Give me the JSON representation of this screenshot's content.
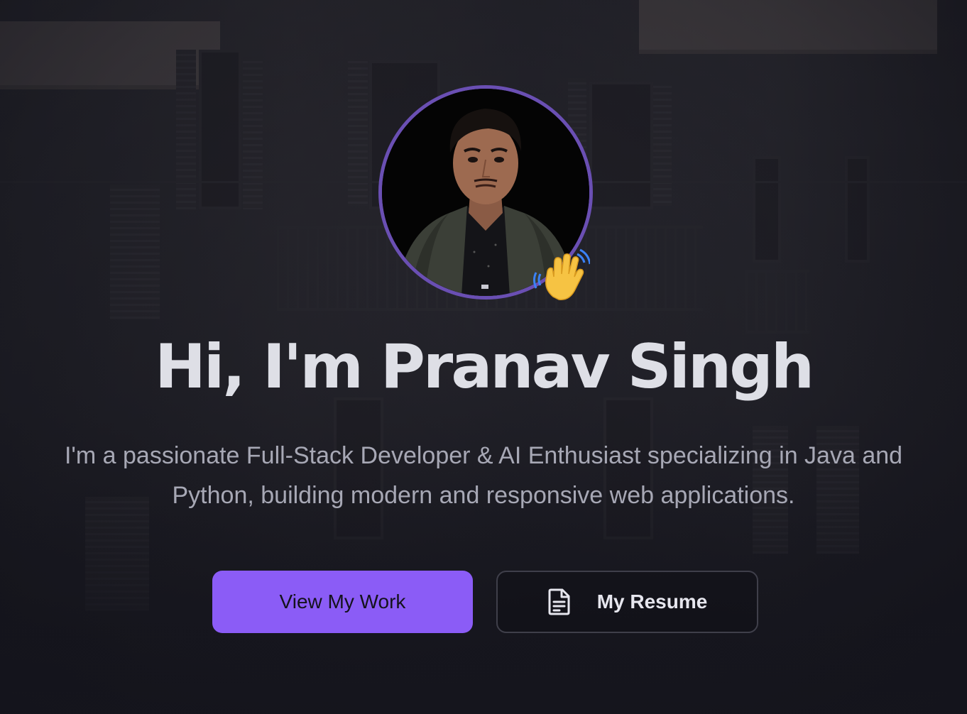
{
  "hero": {
    "title": "Hi, I'm Pranav Singh",
    "subtitle_line1": "I'm a passionate Full-Stack Developer & AI Enthusiast specializing in Java and",
    "subtitle_line2": "Python, building modern and responsive web applications.",
    "avatar_icon": "profile-photo",
    "wave_icon": "waving-hand-icon"
  },
  "buttons": {
    "primary_label": "View My Work",
    "secondary_label": "My Resume",
    "secondary_icon": "document-icon"
  },
  "colors": {
    "accent": "#8b5cf6",
    "avatar_ring": "#6a4fb3",
    "title": "#dedfe6",
    "subtitle": "#a7a8b5",
    "background": "#15151d"
  }
}
